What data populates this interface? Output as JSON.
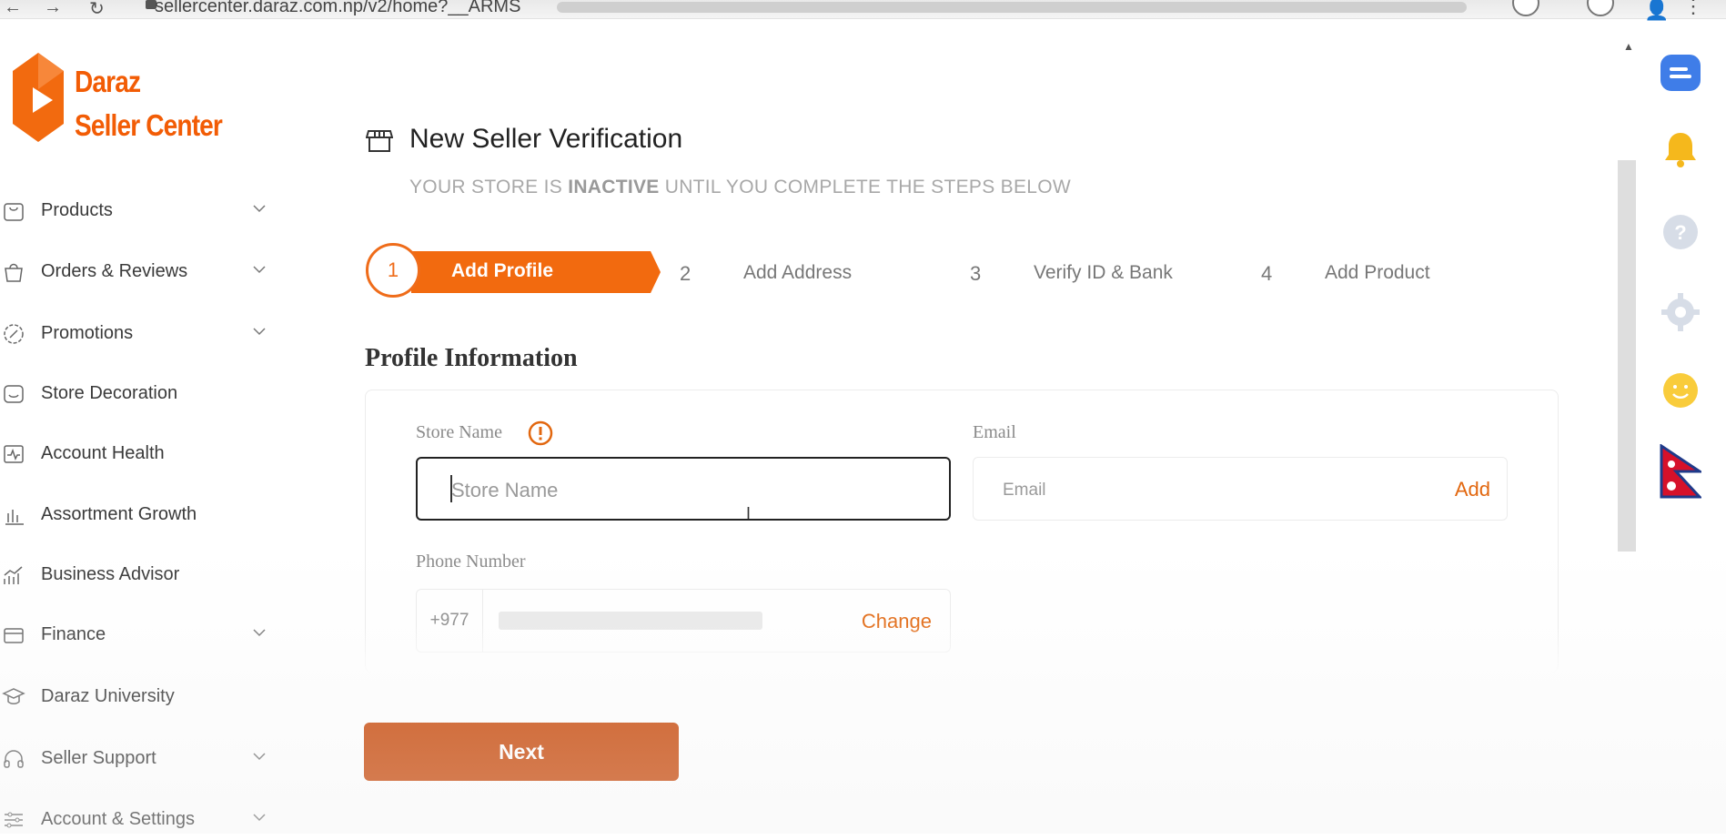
{
  "browser": {
    "url": "sellercenter.daraz.com.np/v2/home?__ARMS"
  },
  "logo": {
    "line1": "Daraz",
    "line2": "Seller Center"
  },
  "sidebar": {
    "items": [
      {
        "label": "Products",
        "icon": "bag-icon",
        "expandable": true
      },
      {
        "label": "Orders & Reviews",
        "icon": "shopping-bag-icon",
        "expandable": true
      },
      {
        "label": "Promotions",
        "icon": "discount-icon",
        "expandable": true
      },
      {
        "label": "Store Decoration",
        "icon": "store-icon",
        "expandable": false
      },
      {
        "label": "Account Health",
        "icon": "health-icon",
        "expandable": false
      },
      {
        "label": "Assortment Growth",
        "icon": "bar-chart-icon",
        "expandable": false
      },
      {
        "label": "Business Advisor",
        "icon": "growth-chart-icon",
        "expandable": false
      },
      {
        "label": "Finance",
        "icon": "card-icon",
        "expandable": true
      },
      {
        "label": "Daraz University",
        "icon": "graduation-icon",
        "expandable": false
      },
      {
        "label": "Seller Support",
        "icon": "headset-icon",
        "expandable": true
      },
      {
        "label": "Account & Settings",
        "icon": "sliders-icon",
        "expandable": true
      }
    ]
  },
  "page": {
    "title": "New Seller Verification",
    "subtitle_pre": "YOUR STORE IS ",
    "subtitle_bold": "INACTIVE",
    "subtitle_post": " UNTIL YOU COMPLETE THE STEPS BELOW"
  },
  "steps": [
    {
      "num": "1",
      "label": "Add Profile",
      "active": true
    },
    {
      "num": "2",
      "label": "Add Address",
      "active": false
    },
    {
      "num": "3",
      "label": "Verify ID & Bank",
      "active": false
    },
    {
      "num": "4",
      "label": "Add Product",
      "active": false
    }
  ],
  "profile": {
    "section_title": "Profile Information",
    "store_name_label": "Store Name",
    "store_name_placeholder": "Store Name",
    "email_label": "Email",
    "email_placeholder": "Email",
    "email_action": "Add",
    "phone_label": "Phone Number",
    "phone_code": "+977",
    "phone_action": "Change"
  },
  "actions": {
    "next_label": "Next"
  },
  "colors": {
    "brand_orange": "#f26a0f",
    "next_button": "#c94c0e",
    "link_orange": "#e2670f"
  },
  "right_rail": [
    "chat-icon",
    "bell-icon",
    "help-icon",
    "gear-icon",
    "smiley-icon",
    "nepal-flag-icon"
  ]
}
